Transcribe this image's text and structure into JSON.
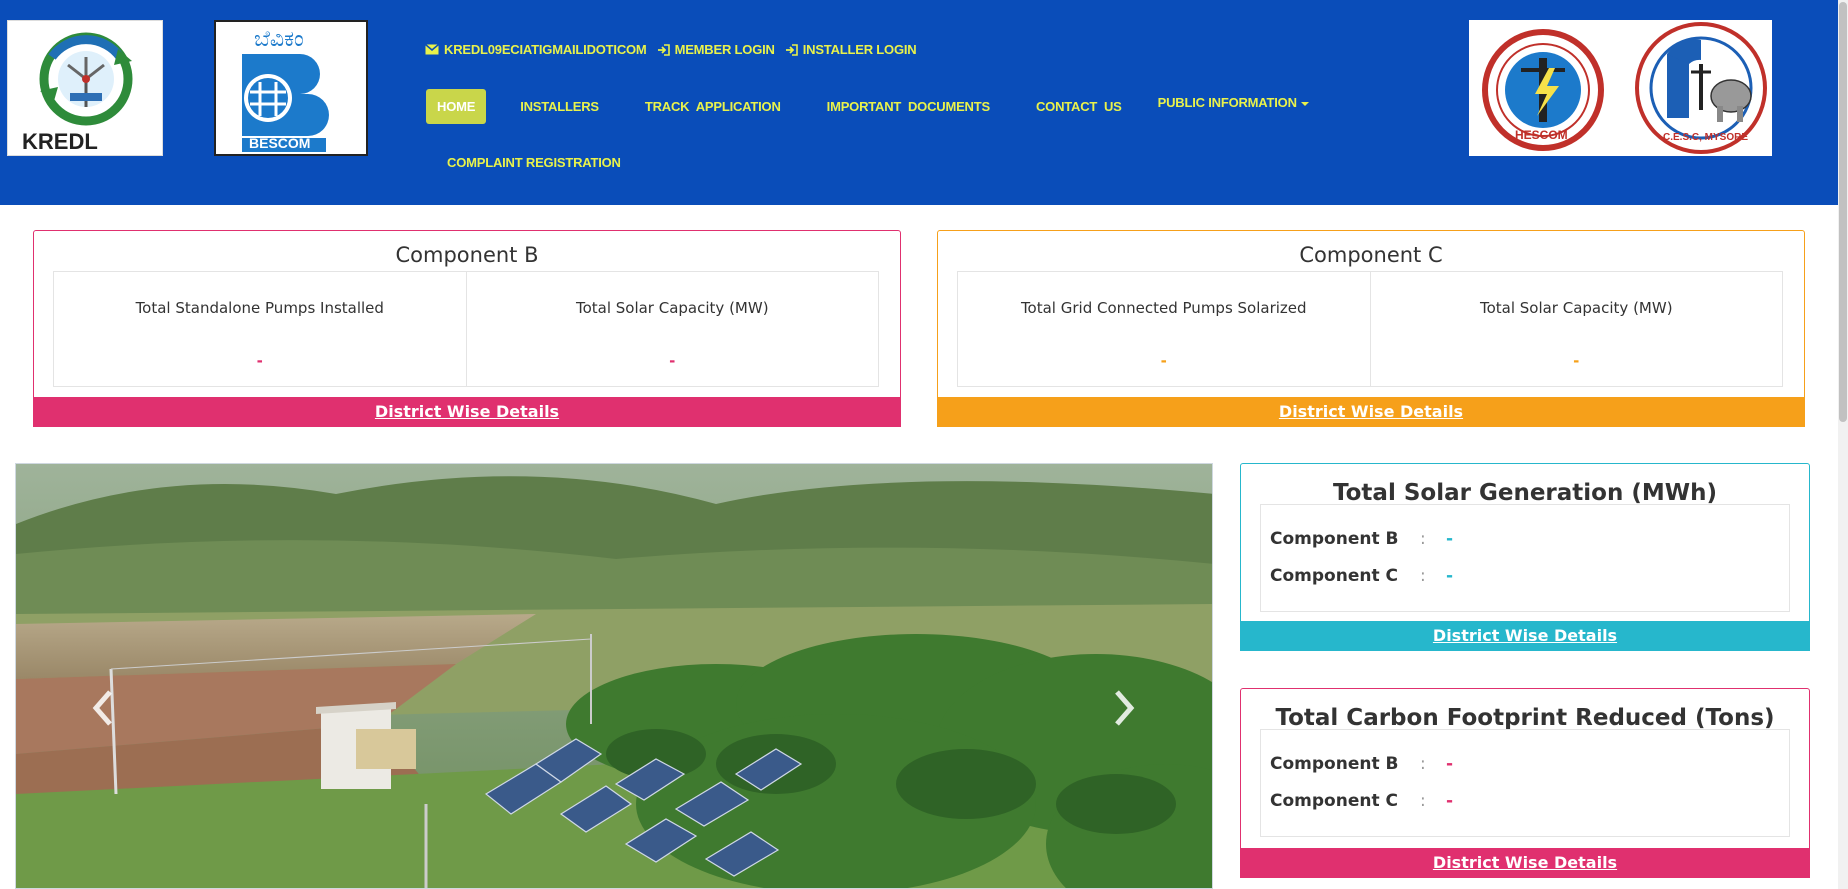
{
  "header": {
    "logos": {
      "kredl": "KREDL",
      "bescom_kannada": "ಬೆವಿಕಂ",
      "bescom": "BESCOM",
      "hescom": "HESCOM",
      "cesc": "C.E.S.C, MYSORE"
    },
    "top_links": {
      "email": "KREDL09ECIATIGMAILIDOTICOM",
      "member_login": "MEMBER LOGIN",
      "installer_login": "INSTALLER LOGIN"
    },
    "nav": {
      "home": "HOME",
      "installers": "INSTALLERS",
      "track": "TRACK  APPLICATION",
      "documents": "IMPORTANT  DOCUMENTS",
      "contact": "CONTACT  US",
      "public_info": "PUBLIC INFORMATION",
      "complaint": "COMPLAINT REGISTRATION"
    },
    "colors": {
      "bar": "#0A4DB9",
      "link": "#E9F24B",
      "active": "#C9D64A"
    }
  },
  "component_b": {
    "title": "Component B",
    "cells": [
      {
        "label": "Total Standalone Pumps Installed",
        "value": "-"
      },
      {
        "label": "Total Solar Capacity (MW)",
        "value": "-"
      }
    ],
    "footer": "District Wise Details",
    "color": "#E0306F"
  },
  "component_c": {
    "title": "Component C",
    "cells": [
      {
        "label": "Total Grid Connected Pumps Solarized",
        "value": "-"
      },
      {
        "label": "Total Solar Capacity (MW)",
        "value": "-"
      }
    ],
    "footer": "District Wise Details",
    "color": "#F6A01A"
  },
  "solar_generation": {
    "title": "Total Solar Generation (MWh)",
    "rows": [
      {
        "label": "Component B",
        "value": "-"
      },
      {
        "label": "Component C",
        "value": "-"
      }
    ],
    "footer": "District Wise Details",
    "color": "#26B7CC"
  },
  "carbon_footprint": {
    "title": "Total Carbon Footprint Reduced (Tons)",
    "rows": [
      {
        "label": "Component B",
        "value": "-"
      },
      {
        "label": "Component C",
        "value": "-"
      }
    ],
    "footer": "District Wise Details",
    "color": "#E0306F"
  },
  "carousel": {
    "prev_icon": "chevron-left-icon",
    "next_icon": "chevron-right-icon"
  }
}
